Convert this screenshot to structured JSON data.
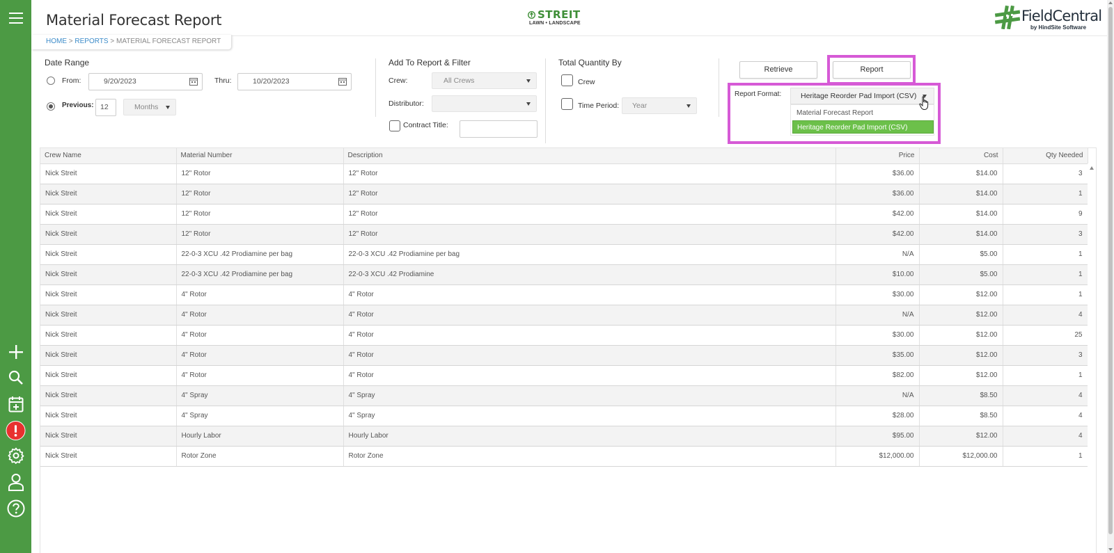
{
  "header": {
    "title": "Material Forecast Report",
    "company_logo": {
      "name": "STREIT",
      "tagline": "LAWN • LANDSCAPE"
    },
    "brand_logo": {
      "name": "FieldCentral",
      "byline": "by HindSite Software"
    }
  },
  "breadcrumb": {
    "home": "HOME",
    "sep1": ">",
    "reports": "REPORTS",
    "sep2": ">",
    "current": "MATERIAL FORECAST REPORT"
  },
  "sidebar": {
    "icons": [
      "menu-icon",
      "plus-icon",
      "search-icon",
      "calendar-icon",
      "alert-icon",
      "gear-icon",
      "user-icon",
      "help-icon"
    ]
  },
  "date_range": {
    "title": "Date Range",
    "from_label": "From:",
    "from_value": "9/20/2023",
    "thru_label": "Thru:",
    "thru_value": "10/20/2023",
    "previous_label": "Previous:",
    "previous_value": "12",
    "period_value": "Months"
  },
  "filter": {
    "title": "Add To Report & Filter",
    "crew_label": "Crew:",
    "crew_value": "All Crews",
    "distributor_label": "Distributor:",
    "distributor_value": "",
    "contract_label": "Contract Title:",
    "contract_value": ""
  },
  "total_qty": {
    "title": "Total Quantity By",
    "crew_label": "Crew",
    "time_period_label": "Time Period:",
    "time_period_value": "Year"
  },
  "actions": {
    "retrieve_label": "Retrieve",
    "report_label": "Report",
    "report_format_label": "Report Format:",
    "report_format_value": "Heritage Reorder Pad Import (CSV)",
    "format_options": [
      "Material Forecast Report",
      "Heritage Reorder Pad Import (CSV)"
    ]
  },
  "colors": {
    "sidebar": "#4c9a44",
    "highlight": "#d65ad6",
    "selected_option": "#6cc04a",
    "link": "#3b8bc9",
    "alert": "#e8312f"
  },
  "table": {
    "columns": [
      "Crew Name",
      "Material Number",
      "Description",
      "Price",
      "Cost",
      "Qty Needed"
    ],
    "rows": [
      [
        "Nick Streit",
        "12\" Rotor",
        "12\" Rotor",
        "$36.00",
        "$14.00",
        "3"
      ],
      [
        "Nick Streit",
        "12\" Rotor",
        "12\" Rotor",
        "$36.00",
        "$14.00",
        "1"
      ],
      [
        "Nick Streit",
        "12\" Rotor",
        "12\" Rotor",
        "$42.00",
        "$14.00",
        "9"
      ],
      [
        "Nick Streit",
        "12\" Rotor",
        "12\" Rotor",
        "$42.00",
        "$14.00",
        "3"
      ],
      [
        "Nick Streit",
        "22-0-3 XCU .42 Prodiamine per bag",
        "22-0-3 XCU .42 Prodiamine per bag",
        "N/A",
        "$5.00",
        "1"
      ],
      [
        "Nick Streit",
        "22-0-3 XCU .42 Prodiamine per bag",
        "22-0-3 XCU .42 Prodiamine",
        "$10.00",
        "$5.00",
        "1"
      ],
      [
        "Nick Streit",
        "4\" Rotor",
        "4\" Rotor",
        "$30.00",
        "$12.00",
        "1"
      ],
      [
        "Nick Streit",
        "4\" Rotor",
        "4\" Rotor",
        "N/A",
        "$12.00",
        "4"
      ],
      [
        "Nick Streit",
        "4\" Rotor",
        "4\" Rotor",
        "$30.00",
        "$12.00",
        "25"
      ],
      [
        "Nick Streit",
        "4\" Rotor",
        "4\" Rotor",
        "$35.00",
        "$12.00",
        "3"
      ],
      [
        "Nick Streit",
        "4\" Rotor",
        "4\" Rotor",
        "$82.00",
        "$12.00",
        "1"
      ],
      [
        "Nick Streit",
        "4\" Spray",
        "4\" Spray",
        "N/A",
        "$8.50",
        "4"
      ],
      [
        "Nick Streit",
        "4\" Spray",
        "4\" Spray",
        "$28.00",
        "$8.50",
        "4"
      ],
      [
        "Nick Streit",
        "Hourly Labor",
        "Hourly Labor",
        "$95.00",
        "$12.00",
        "4"
      ],
      [
        "Nick Streit",
        "Rotor Zone",
        "Rotor Zone",
        "$12,000.00",
        "$12,000.00",
        "1"
      ]
    ]
  }
}
